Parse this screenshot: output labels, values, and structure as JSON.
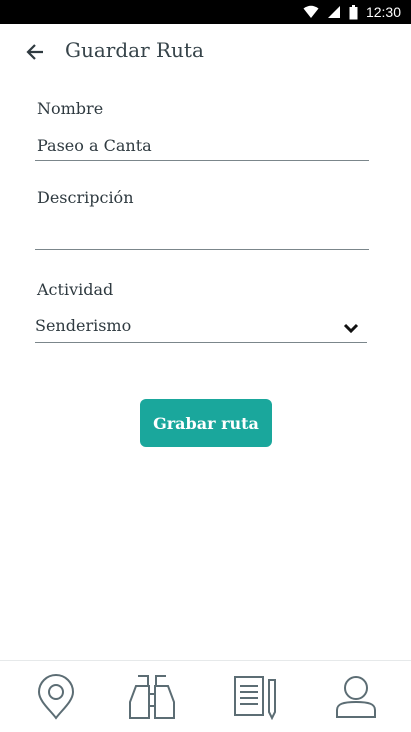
{
  "status_bar": {
    "time": "12:30"
  },
  "header": {
    "title": "Guardar Ruta"
  },
  "form": {
    "name": {
      "label": "Nombre",
      "value": "Paseo a Canta"
    },
    "description": {
      "label": "Descripción",
      "value": ""
    },
    "activity": {
      "label": "Actividad",
      "selected": "Senderismo"
    }
  },
  "actions": {
    "record_label": "Grabar ruta"
  },
  "colors": {
    "accent": "#1aa79c",
    "text": "#2f3a40",
    "icon": "#5c6d74"
  },
  "bottom_nav": {
    "items": [
      {
        "icon": "location-pin-icon"
      },
      {
        "icon": "binoculars-icon"
      },
      {
        "icon": "notes-icon"
      },
      {
        "icon": "profile-icon"
      }
    ]
  }
}
